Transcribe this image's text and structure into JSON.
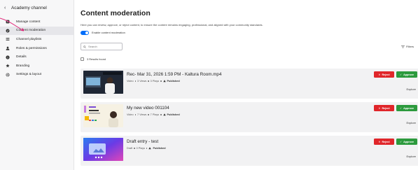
{
  "sidebar": {
    "back_label": "Academy channel",
    "items": [
      {
        "label": "Manage content",
        "icon": "upload-icon"
      },
      {
        "label": "Content moderation",
        "icon": "shield-check-icon"
      },
      {
        "label": "Channel playlists",
        "icon": "list-icon"
      },
      {
        "label": "Roles & permissions",
        "icon": "person-icon"
      },
      {
        "label": "Details",
        "icon": "info-icon"
      },
      {
        "label": "Branding",
        "icon": "star-icon"
      },
      {
        "label": "Settings & layout",
        "icon": "gear-icon"
      }
    ],
    "active_index": 1
  },
  "main": {
    "title": "Content moderation",
    "description": "Here you can review, approve, or reject content, to ensure the content remains engaging, professional, and aligned with your community standards.",
    "toggle_label": "Enable content moderation",
    "toggle_on": true,
    "search_placeholder": "Search",
    "filters_label": "Filters",
    "results_label": "3 Results found"
  },
  "cards": [
    {
      "title": "Rec- Mar 31, 2026 1:59 PM - Kaltura Room.mp4",
      "type": "Video",
      "views": "3 Views",
      "plays": "3 Plays",
      "status": "Published"
    },
    {
      "title": "My new video 001104",
      "type": "Video",
      "views": "7 Views",
      "plays": "7 Plays",
      "status": "Published"
    },
    {
      "title": "Draft entry - test",
      "type": "Draft",
      "views": "",
      "plays": "0 Plays",
      "status": "Published"
    }
  ],
  "actions": {
    "reject": "Reject",
    "approve": "Approve",
    "explore": "Explore"
  },
  "colors": {
    "accent": "#006efa",
    "reject": "#e0262a",
    "approve": "#2c9a3d",
    "annotation": "#e0287a"
  }
}
